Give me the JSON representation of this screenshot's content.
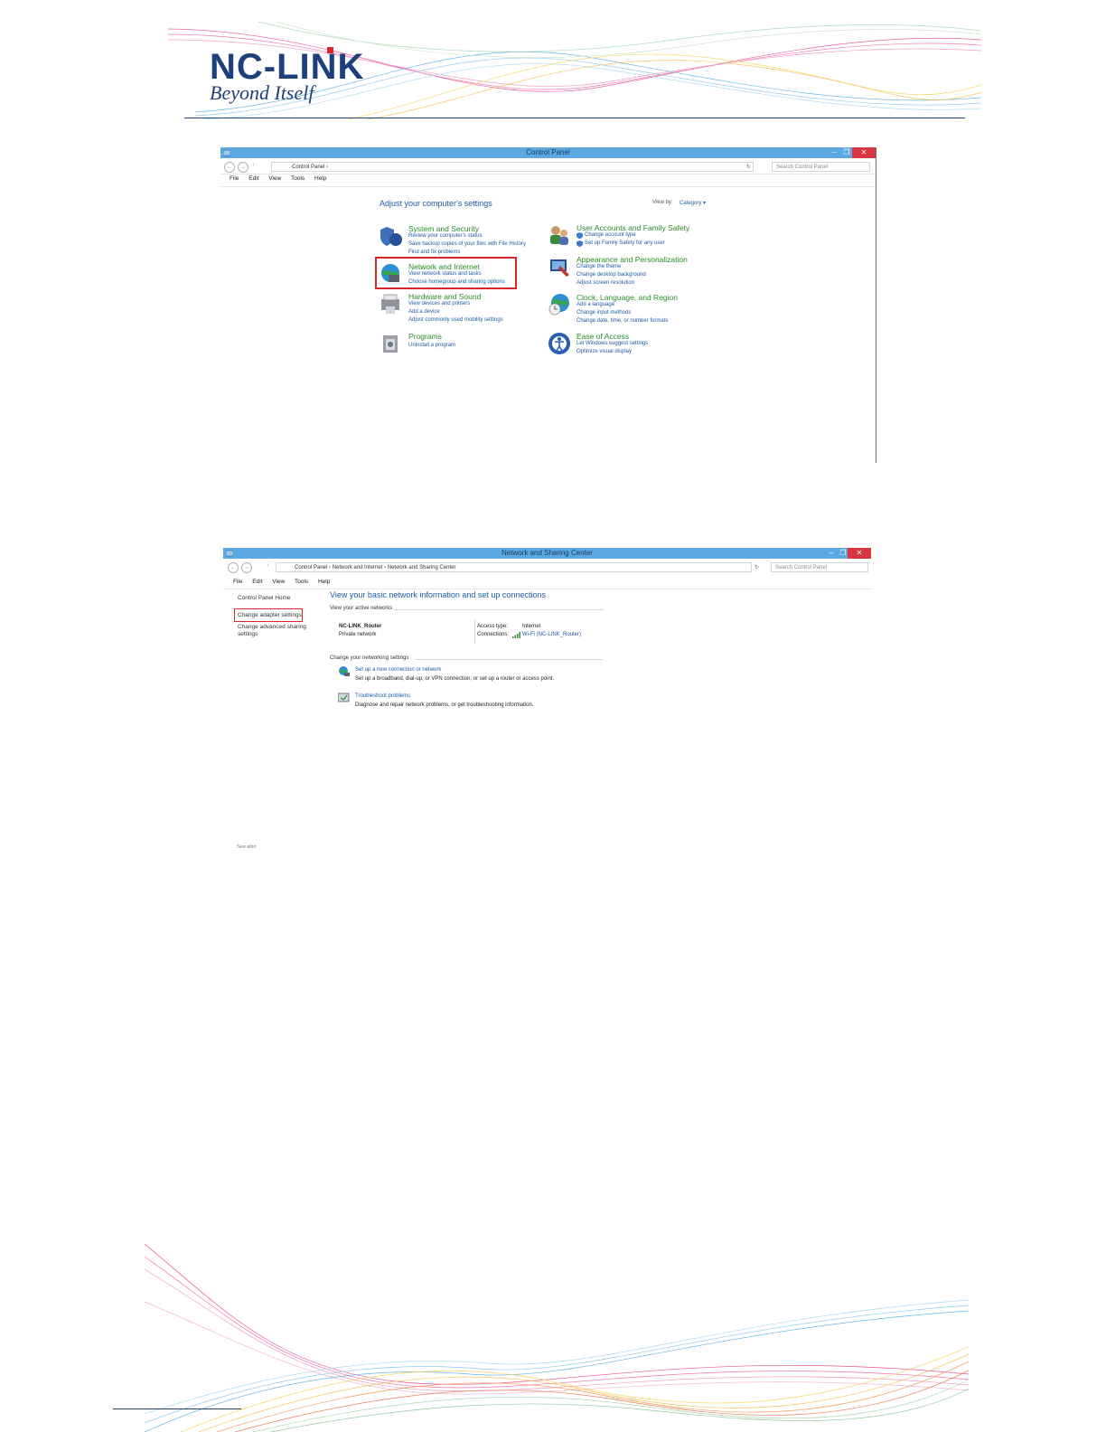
{
  "header": {
    "logo_text": "NC-LINK",
    "tagline": "Beyond Itself"
  },
  "control_panel": {
    "window_title": "Control Panel",
    "address": "Control Panel",
    "search_placeholder": "Search Control Panel",
    "menu": [
      "File",
      "Edit",
      "View",
      "Tools",
      "Help"
    ],
    "heading": "Adjust your computer's settings",
    "view_by_label": "View by:",
    "view_by_value": "Category",
    "categories": [
      {
        "title": "System and Security",
        "links": [
          "Review your computer's status",
          "Save backup copies of your files with File History",
          "Find and fix problems"
        ]
      },
      {
        "title": "Network and Internet",
        "links": [
          "View network status and tasks",
          "Choose homegroup and sharing options"
        ]
      },
      {
        "title": "Hardware and Sound",
        "links": [
          "View devices and printers",
          "Add a device",
          "Adjust commonly used mobility settings"
        ]
      },
      {
        "title": "Programs",
        "links": [
          "Uninstall a program"
        ]
      },
      {
        "title": "User Accounts and Family Safety",
        "links": [
          "Change account type",
          "Set up Family Safety for any user"
        ]
      },
      {
        "title": "Appearance and Personalization",
        "links": [
          "Change the theme",
          "Change desktop background",
          "Adjust screen resolution"
        ]
      },
      {
        "title": "Clock, Language, and Region",
        "links": [
          "Add a language",
          "Change input methods",
          "Change date, time, or number formats"
        ]
      },
      {
        "title": "Ease of Access",
        "links": [
          "Let Windows suggest settings",
          "Optimize visual display"
        ]
      }
    ]
  },
  "network_center": {
    "window_title": "Network and Sharing Center",
    "breadcrumb": [
      "Control Panel",
      "Network and Internet",
      "Network and Sharing Center"
    ],
    "search_placeholder": "Search Control Panel",
    "menu": [
      "File",
      "Edit",
      "View",
      "Tools",
      "Help"
    ],
    "sidebar": {
      "home": "Control Panel Home",
      "adapter": "Change adapter settings",
      "advanced_line1": "Change advanced sharing",
      "advanced_line2": "settings",
      "see_also": "See also"
    },
    "heading": "View your basic network information and set up connections",
    "active_networks_label": "View your active networks",
    "network_name": "NC-LINK_Router",
    "network_type": "Private network",
    "access_type_label": "Access type:",
    "access_type_value": "Internet",
    "connections_label": "Connections:",
    "connections_value": "Wi-Fi (NC-LINK_Router)",
    "change_settings_label": "Change your networking settings",
    "tasks": [
      {
        "link": "Set up a new connection or network",
        "desc": "Set up a broadband, dial-up, or VPN connection; or set up a router or access point."
      },
      {
        "link": "Troubleshoot problems",
        "desc": "Diagnose and repair network problems, or get troubleshooting information."
      }
    ]
  }
}
